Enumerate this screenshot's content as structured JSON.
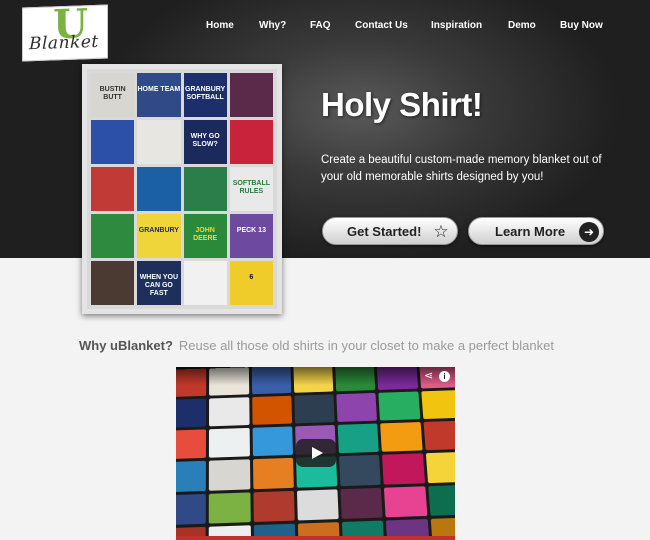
{
  "brand": {
    "logo_letter": "U",
    "logo_word": "Blanket",
    "accent_green": "#7bb243"
  },
  "nav": {
    "items": [
      {
        "label": "Home"
      },
      {
        "label": "Why?"
      },
      {
        "label": "FAQ"
      },
      {
        "label": "Contact Us"
      },
      {
        "label": "Inspiration"
      },
      {
        "label": "Demo"
      },
      {
        "label": "Buy Now"
      }
    ]
  },
  "hero": {
    "headline": "Holy Shirt!",
    "subtext": "Create a beautiful custom-made memory blanket out of your old memorable shirts designed by you!",
    "get_started_label": "Get Started!",
    "get_started_icon": "star-icon",
    "learn_more_label": "Learn More",
    "learn_more_icon": "arrow-right-icon"
  },
  "quilt": {
    "patches": [
      {
        "text": "BUSTIN BUTT",
        "bg": "#d8d6d0",
        "fg": "#333"
      },
      {
        "text": "HOME TEAM",
        "bg": "#2f4a86",
        "fg": "#fff"
      },
      {
        "text": "GRANBURY SOFTBALL",
        "bg": "#1d2f6b",
        "fg": "#fff"
      },
      {
        "text": "",
        "bg": "#5b2a4a",
        "fg": "#fff"
      },
      {
        "text": "",
        "bg": "#2c4fa8",
        "fg": "#fff"
      },
      {
        "text": "",
        "bg": "#e7e6e1",
        "fg": "#2a7a3c"
      },
      {
        "text": "WHY GO SLOW?",
        "bg": "#1a2a5c",
        "fg": "#fff"
      },
      {
        "text": "",
        "bg": "#c8233a",
        "fg": "#fff"
      },
      {
        "text": "",
        "bg": "#c23a35",
        "fg": "#f3d34a"
      },
      {
        "text": "",
        "bg": "#1b5fa5",
        "fg": "#fff"
      },
      {
        "text": "",
        "bg": "#2b7d4a",
        "fg": "#fff"
      },
      {
        "text": "SOFTBALL RULES",
        "bg": "#e9e9e9",
        "fg": "#2a7a3c"
      },
      {
        "text": "",
        "bg": "#2d8a3e",
        "fg": "#fff"
      },
      {
        "text": "GRANBURY",
        "bg": "#efd43a",
        "fg": "#1a2a5c"
      },
      {
        "text": "JOHN DEERE",
        "bg": "#2b8a3a",
        "fg": "#f5d43a"
      },
      {
        "text": "PECK 13",
        "bg": "#6d4aa0",
        "fg": "#fff"
      },
      {
        "text": "",
        "bg": "#4a3a32",
        "fg": "#fff"
      },
      {
        "text": "WHEN YOU CAN GO FAST",
        "bg": "#1e2f5e",
        "fg": "#fff"
      },
      {
        "text": "",
        "bg": "#f1f1f1",
        "fg": "#c2185b"
      },
      {
        "text": "6",
        "bg": "#f0cc2a",
        "fg": "#111"
      }
    ]
  },
  "intro": {
    "label": "Why uBlanket?",
    "text": "Reuse all those old shirts in your closet to make a perfect blanket"
  },
  "video": {
    "share_icon": "share-icon",
    "info_icon": "info-icon",
    "info_glyph": "i",
    "colors": [
      "#c0392b",
      "#e8e4d8",
      "#3a5fa8",
      "#f3d34a",
      "#2b8a3a",
      "#7a2a9a",
      "#e05a8a",
      "#1d2f6b",
      "#e9e9e9",
      "#d35400",
      "#2c3e50",
      "#8e44ad",
      "#27ae60",
      "#f1c40f",
      "#e74c3c",
      "#ecf0f1",
      "#3498db",
      "#9b59b6",
      "#16a085",
      "#f39c12",
      "#c0392b",
      "#2980b9",
      "#d8d6d0",
      "#e67e22",
      "#1abc9c",
      "#34495e",
      "#c2185b",
      "#f5d43a",
      "#2f4a86",
      "#7bb243",
      "#b03a2e",
      "#dcdcdc",
      "#5b2a4a",
      "#e84393",
      "#0c6e4f",
      "#a93226",
      "#eeeeee",
      "#1f618d",
      "#ca6f1e",
      "#117a65",
      "#6c3483",
      "#b9770e"
    ]
  }
}
